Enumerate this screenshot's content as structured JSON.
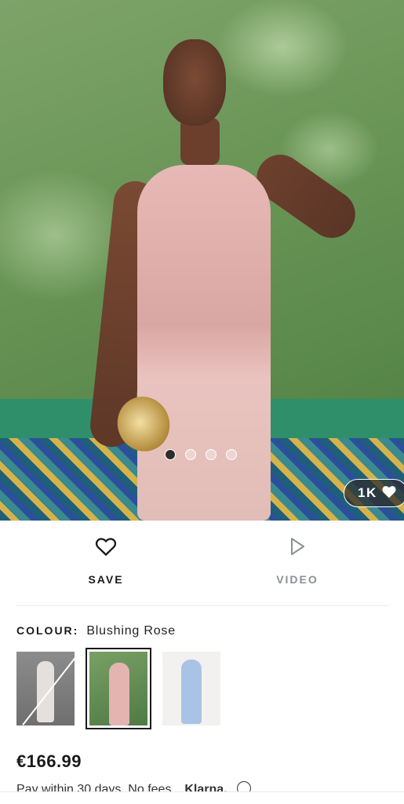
{
  "gallery": {
    "dots": [
      {
        "active": true
      },
      {
        "active": false
      },
      {
        "active": false
      },
      {
        "active": false
      }
    ],
    "likes": "1K",
    "likes_icon": "heart-icon"
  },
  "actions": {
    "save": {
      "label": "SAVE",
      "icon": "heart-outline-icon"
    },
    "video": {
      "label": "VIDEO",
      "icon": "play-outline-icon"
    }
  },
  "colour": {
    "label": "COLOUR:",
    "value": "Blushing Rose",
    "swatches": [
      "unavailable",
      "selected",
      "available"
    ]
  },
  "price": "€166.99",
  "payment": {
    "text": "Pay within 30 days. No fees.",
    "provider": "Klarna.",
    "icon": "info-icon"
  },
  "colors": {
    "accent": "#1a1a1a",
    "muted": "#8a8f96"
  }
}
